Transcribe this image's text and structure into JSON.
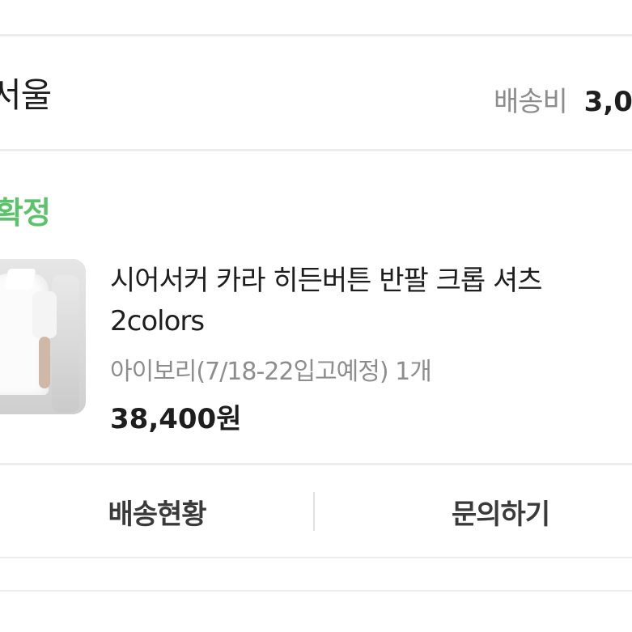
{
  "order": {
    "store_name": "서울",
    "shipping_label": "배송비",
    "shipping_value": "3,0",
    "status": "확정"
  },
  "product": {
    "title_line1": "시어서커 카라 히든버튼 반팔 크롭 셔츠",
    "title_line2": "2colors",
    "option": "아이보리(7/18-22입고예정) 1개",
    "price": "38,400원",
    "thumbnail_icon": "product-photo"
  },
  "actions": {
    "delivery_status_label": "배송현황",
    "inquiry_label": "문의하기"
  },
  "colors": {
    "status_green": "#5cc26c",
    "divider": "#ececec",
    "muted_text": "#8d8d8d"
  }
}
